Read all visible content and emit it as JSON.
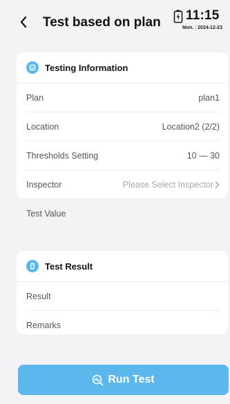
{
  "header": {
    "title": "Test based on plan",
    "back_icon": "chevron-left-icon"
  },
  "status_bar": {
    "time": "11:15",
    "day": "Mon.",
    "date": "2024-12-23",
    "battery_icon": "battery-charging-icon"
  },
  "testing_info": {
    "title": "Testing Information",
    "icon": "info-icon",
    "rows": [
      {
        "label": "Plan",
        "value": "plan1"
      },
      {
        "label": "Location",
        "value": "Location2 (2/2)"
      },
      {
        "label": "Thresholds Setting",
        "value": "10 — 30"
      },
      {
        "label": "Inspector",
        "placeholder": "Please Select Inspector"
      },
      {
        "label": "Test Value",
        "value": ""
      }
    ]
  },
  "test_result": {
    "title": "Test Result",
    "icon": "result-icon",
    "rows": [
      {
        "label": "Result",
        "value": ""
      },
      {
        "label": "Remarks",
        "value": ""
      }
    ]
  },
  "run_button": {
    "label": "Run Test",
    "icon": "run-test-icon"
  },
  "colors": {
    "accent": "#5bb7ec",
    "background": "#f3f3f5"
  }
}
